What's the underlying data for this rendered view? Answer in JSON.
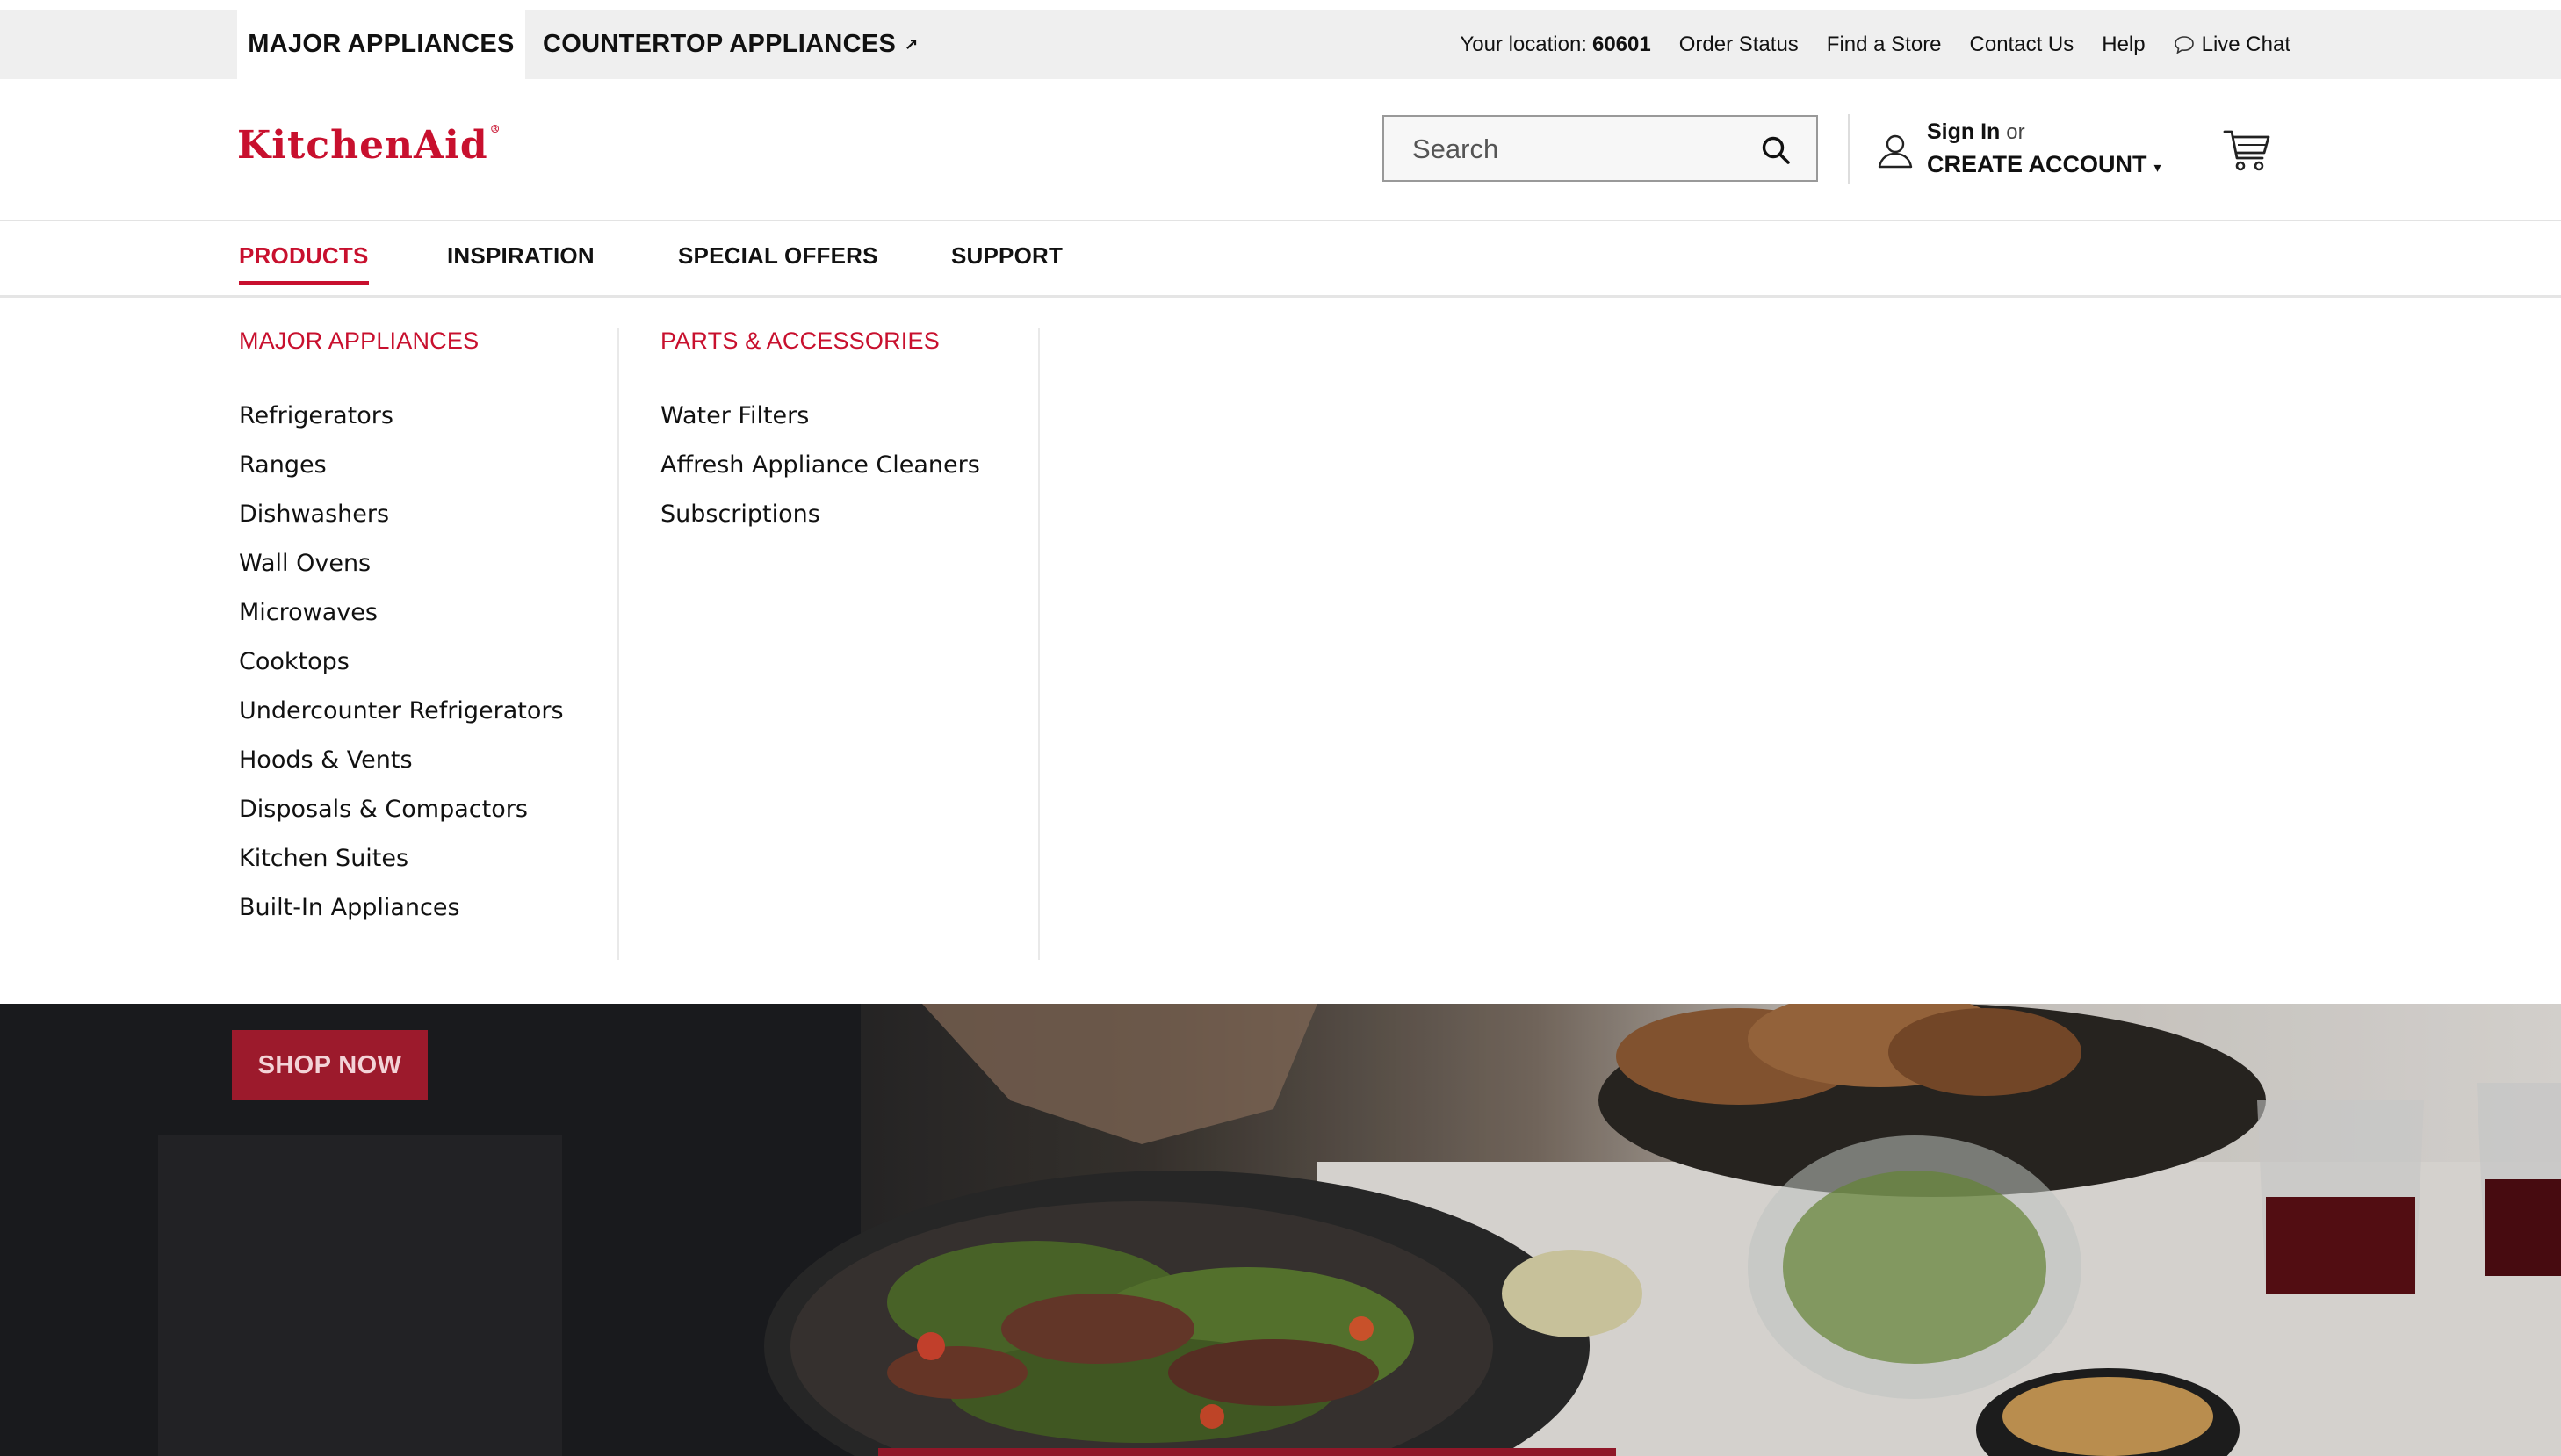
{
  "utility_bar": {
    "tabs": [
      {
        "label": "MAJOR APPLIANCES",
        "active": true
      },
      {
        "label": "COUNTERTOP APPLIANCES",
        "external_icon": "arrow-up-right-icon"
      }
    ],
    "location_label": "Your location:",
    "location_code": "60601",
    "links": {
      "order_status": "Order Status",
      "find_store": "Find a Store",
      "contact_us": "Contact Us",
      "help": "Help",
      "live_chat": "Live Chat"
    },
    "external_glyph": "↗"
  },
  "header": {
    "logo_text": "KitchenAid",
    "logo_mark": "®",
    "search": {
      "placeholder": "Search",
      "value": ""
    },
    "account": {
      "sign_in": "Sign In",
      "or": "or",
      "create_account": "CREATE ACCOUNT",
      "caret": "▾"
    },
    "brand_color": "#c8102e"
  },
  "main_nav": {
    "items": [
      {
        "label": "PRODUCTS",
        "active": true
      },
      {
        "label": "INSPIRATION"
      },
      {
        "label": "SPECIAL OFFERS"
      },
      {
        "label": "SUPPORT"
      }
    ]
  },
  "mega_menu": {
    "columns": [
      {
        "heading": "MAJOR APPLIANCES",
        "links": [
          "Refrigerators",
          "Ranges",
          "Dishwashers",
          "Wall Ovens",
          "Microwaves",
          "Cooktops",
          "Undercounter Refrigerators",
          "Hoods & Vents",
          "Disposals & Compactors",
          "Kitchen Suites",
          "Built-In Appliances"
        ]
      },
      {
        "heading": "PARTS & ACCESSORIES",
        "links": [
          "Water Filters",
          "Affresh Appliance Cleaners",
          "Subscriptions"
        ]
      }
    ]
  },
  "hero": {
    "cta_label": "SHOP NOW",
    "cta_color": "#9c1a2c"
  }
}
